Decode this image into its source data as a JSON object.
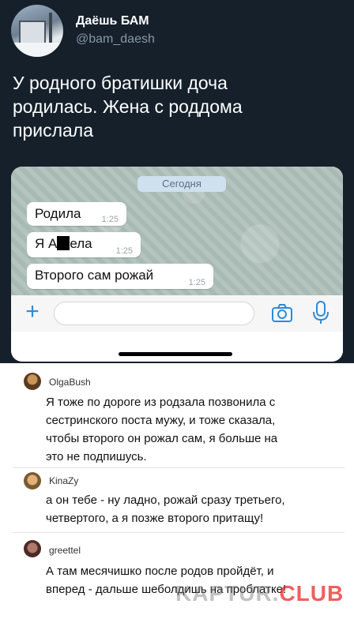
{
  "tweet": {
    "display_name": "Даёшь БАМ",
    "handle": "@bam_daesh",
    "text_lines": [
      "У родного братишки доча",
      "родилась. Жена с роддома",
      "прислала"
    ]
  },
  "chat": {
    "date_label": "Сегодня",
    "messages": [
      {
        "text": "Родила",
        "time": "1:25"
      },
      {
        "text_before": "Я А",
        "text_after": "ела",
        "time": "1:25"
      },
      {
        "text": "Второго сам рожай",
        "time": "1:25"
      }
    ],
    "input_placeholder": "",
    "icons": [
      "plus-icon",
      "camera-icon",
      "microphone-icon"
    ]
  },
  "comments": [
    {
      "user": "OlgaBush",
      "lines": [
        "Я тоже по дороге из родзала позвонила с",
        "сестринского поста мужу, и тоже сказала,",
        "чтобы второго он рожал сам, я больше на",
        "это не подпишусь."
      ]
    },
    {
      "user": "KinaZy",
      "lines": [
        "а он тебе - ну ладно, рожай сразу третьего,",
        "четвертого, а я позже второго притащу!"
      ]
    },
    {
      "user": "greettel",
      "lines": [
        "А там месячишко после родов пройдёт, и",
        "вперед - дальше шеболдишь на проблатке!"
      ]
    }
  ],
  "watermark": {
    "prefix": "KAPTUR.",
    "suffix": "CLUB"
  },
  "colors": {
    "tweet_bg": "#15202b",
    "accent_blue": "#2e8bd8",
    "watermark_red": "#eb2828"
  }
}
